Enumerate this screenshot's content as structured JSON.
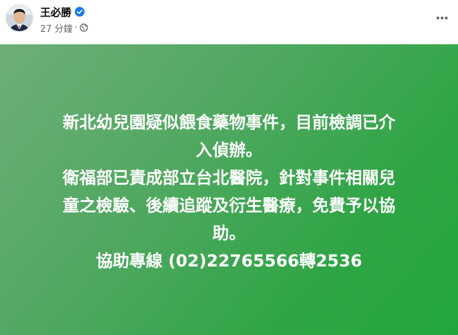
{
  "post": {
    "author_name": "王必勝",
    "timestamp": "27 分鐘",
    "separator": "·",
    "privacy_icon": "globe-icon",
    "verified_icon": "verified-badge-icon",
    "more_icon": "more-options-icon"
  },
  "content": {
    "background_colors": [
      "#6fae79",
      "#22a63f"
    ],
    "lines": [
      "新北幼兒園疑似餵食藥物事件，目前檢調已介",
      "入偵辦。",
      "衛福部已責成部立台北醫院，針對事件相關兒",
      "童之檢驗、後續追蹤及衍生醫療，免費予以協",
      "助。",
      "協助專線 (02)22765566轉2536"
    ]
  },
  "colors": {
    "verified": "#1877f2",
    "meta_text": "#65676b",
    "name_text": "#050505"
  }
}
